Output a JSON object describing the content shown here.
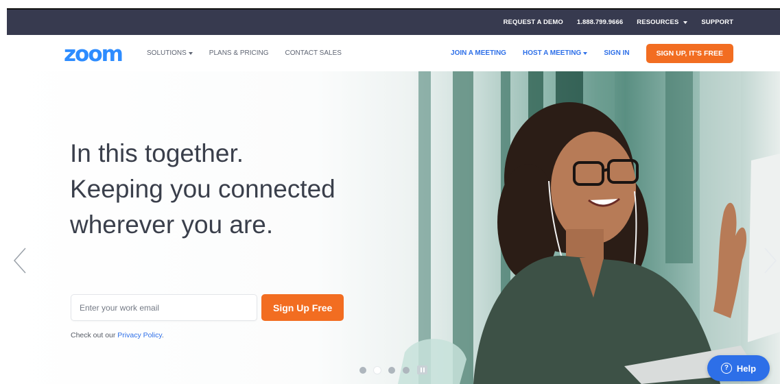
{
  "utility_bar": {
    "request_demo": "REQUEST A DEMO",
    "phone": "1.888.799.9666",
    "resources": "RESOURCES",
    "support": "SUPPORT"
  },
  "nav": {
    "logo": "zoom",
    "solutions": "SOLUTIONS",
    "plans_pricing": "PLANS & PRICING",
    "contact_sales": "CONTACT SALES",
    "join_meeting": "JOIN A MEETING",
    "host_meeting": "HOST A MEETING",
    "sign_in": "SIGN IN",
    "sign_up": "SIGN UP, IT'S FREE"
  },
  "hero": {
    "headline_lines": [
      "In this together.",
      "Keeping you connected",
      "wherever you are."
    ],
    "email_placeholder": "Enter your work email",
    "signup_button": "Sign Up Free",
    "privacy_prefix": "Check out our ",
    "privacy_link": "Privacy Policy",
    "privacy_suffix": ".",
    "active_slide": 2,
    "slide_count": 4
  },
  "help_widget": {
    "label": "Help"
  },
  "colors": {
    "brand_blue": "#2d8cff",
    "link_blue": "#2d6fe8",
    "accent_orange": "#f26d21",
    "utility_bar": "#373a4f"
  },
  "icons": {
    "prev": "chevron-left-icon",
    "next": "chevron-right-icon",
    "help": "question-circle-icon",
    "dropdown": "caret-down-icon",
    "pause": "pause-icon"
  }
}
